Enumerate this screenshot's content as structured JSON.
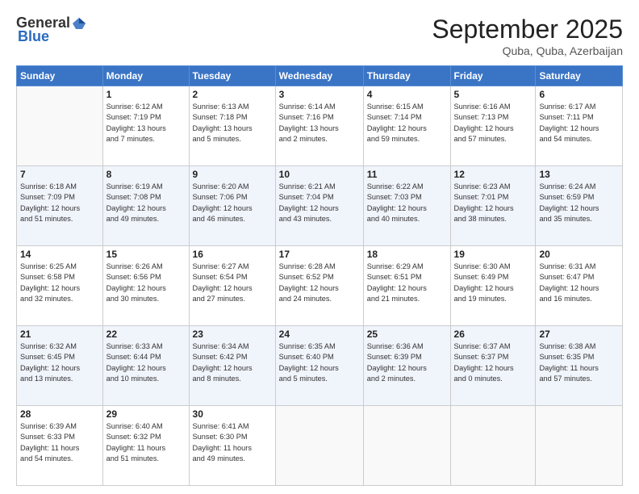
{
  "header": {
    "logo_general": "General",
    "logo_blue": "Blue",
    "month_title": "September 2025",
    "location": "Quba, Quba, Azerbaijan"
  },
  "weekdays": [
    "Sunday",
    "Monday",
    "Tuesday",
    "Wednesday",
    "Thursday",
    "Friday",
    "Saturday"
  ],
  "weeks": [
    [
      {
        "day": "",
        "info": ""
      },
      {
        "day": "1",
        "info": "Sunrise: 6:12 AM\nSunset: 7:19 PM\nDaylight: 13 hours\nand 7 minutes."
      },
      {
        "day": "2",
        "info": "Sunrise: 6:13 AM\nSunset: 7:18 PM\nDaylight: 13 hours\nand 5 minutes."
      },
      {
        "day": "3",
        "info": "Sunrise: 6:14 AM\nSunset: 7:16 PM\nDaylight: 13 hours\nand 2 minutes."
      },
      {
        "day": "4",
        "info": "Sunrise: 6:15 AM\nSunset: 7:14 PM\nDaylight: 12 hours\nand 59 minutes."
      },
      {
        "day": "5",
        "info": "Sunrise: 6:16 AM\nSunset: 7:13 PM\nDaylight: 12 hours\nand 57 minutes."
      },
      {
        "day": "6",
        "info": "Sunrise: 6:17 AM\nSunset: 7:11 PM\nDaylight: 12 hours\nand 54 minutes."
      }
    ],
    [
      {
        "day": "7",
        "info": "Sunrise: 6:18 AM\nSunset: 7:09 PM\nDaylight: 12 hours\nand 51 minutes."
      },
      {
        "day": "8",
        "info": "Sunrise: 6:19 AM\nSunset: 7:08 PM\nDaylight: 12 hours\nand 49 minutes."
      },
      {
        "day": "9",
        "info": "Sunrise: 6:20 AM\nSunset: 7:06 PM\nDaylight: 12 hours\nand 46 minutes."
      },
      {
        "day": "10",
        "info": "Sunrise: 6:21 AM\nSunset: 7:04 PM\nDaylight: 12 hours\nand 43 minutes."
      },
      {
        "day": "11",
        "info": "Sunrise: 6:22 AM\nSunset: 7:03 PM\nDaylight: 12 hours\nand 40 minutes."
      },
      {
        "day": "12",
        "info": "Sunrise: 6:23 AM\nSunset: 7:01 PM\nDaylight: 12 hours\nand 38 minutes."
      },
      {
        "day": "13",
        "info": "Sunrise: 6:24 AM\nSunset: 6:59 PM\nDaylight: 12 hours\nand 35 minutes."
      }
    ],
    [
      {
        "day": "14",
        "info": "Sunrise: 6:25 AM\nSunset: 6:58 PM\nDaylight: 12 hours\nand 32 minutes."
      },
      {
        "day": "15",
        "info": "Sunrise: 6:26 AM\nSunset: 6:56 PM\nDaylight: 12 hours\nand 30 minutes."
      },
      {
        "day": "16",
        "info": "Sunrise: 6:27 AM\nSunset: 6:54 PM\nDaylight: 12 hours\nand 27 minutes."
      },
      {
        "day": "17",
        "info": "Sunrise: 6:28 AM\nSunset: 6:52 PM\nDaylight: 12 hours\nand 24 minutes."
      },
      {
        "day": "18",
        "info": "Sunrise: 6:29 AM\nSunset: 6:51 PM\nDaylight: 12 hours\nand 21 minutes."
      },
      {
        "day": "19",
        "info": "Sunrise: 6:30 AM\nSunset: 6:49 PM\nDaylight: 12 hours\nand 19 minutes."
      },
      {
        "day": "20",
        "info": "Sunrise: 6:31 AM\nSunset: 6:47 PM\nDaylight: 12 hours\nand 16 minutes."
      }
    ],
    [
      {
        "day": "21",
        "info": "Sunrise: 6:32 AM\nSunset: 6:45 PM\nDaylight: 12 hours\nand 13 minutes."
      },
      {
        "day": "22",
        "info": "Sunrise: 6:33 AM\nSunset: 6:44 PM\nDaylight: 12 hours\nand 10 minutes."
      },
      {
        "day": "23",
        "info": "Sunrise: 6:34 AM\nSunset: 6:42 PM\nDaylight: 12 hours\nand 8 minutes."
      },
      {
        "day": "24",
        "info": "Sunrise: 6:35 AM\nSunset: 6:40 PM\nDaylight: 12 hours\nand 5 minutes."
      },
      {
        "day": "25",
        "info": "Sunrise: 6:36 AM\nSunset: 6:39 PM\nDaylight: 12 hours\nand 2 minutes."
      },
      {
        "day": "26",
        "info": "Sunrise: 6:37 AM\nSunset: 6:37 PM\nDaylight: 12 hours\nand 0 minutes."
      },
      {
        "day": "27",
        "info": "Sunrise: 6:38 AM\nSunset: 6:35 PM\nDaylight: 11 hours\nand 57 minutes."
      }
    ],
    [
      {
        "day": "28",
        "info": "Sunrise: 6:39 AM\nSunset: 6:33 PM\nDaylight: 11 hours\nand 54 minutes."
      },
      {
        "day": "29",
        "info": "Sunrise: 6:40 AM\nSunset: 6:32 PM\nDaylight: 11 hours\nand 51 minutes."
      },
      {
        "day": "30",
        "info": "Sunrise: 6:41 AM\nSunset: 6:30 PM\nDaylight: 11 hours\nand 49 minutes."
      },
      {
        "day": "",
        "info": ""
      },
      {
        "day": "",
        "info": ""
      },
      {
        "day": "",
        "info": ""
      },
      {
        "day": "",
        "info": ""
      }
    ]
  ]
}
